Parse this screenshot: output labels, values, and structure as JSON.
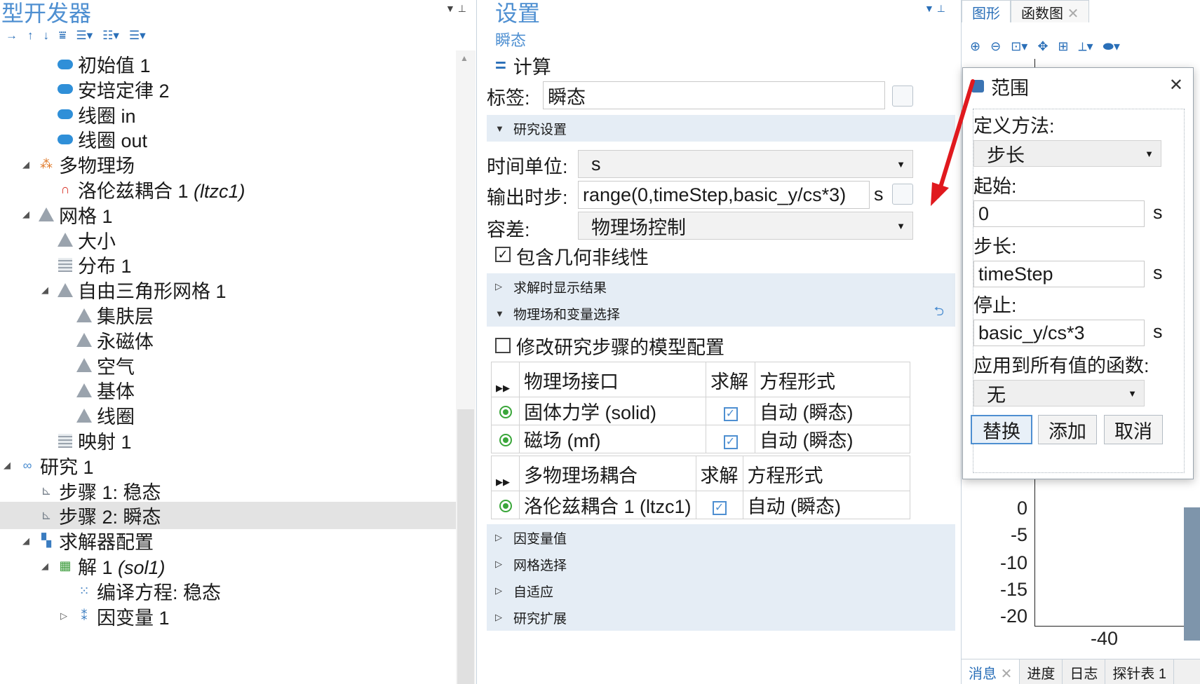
{
  "left": {
    "title": "型开发器",
    "tree": [
      {
        "indent": 3,
        "icon": "initial-values-icon",
        "label": "初始值 1"
      },
      {
        "indent": 3,
        "icon": "ampere-law-icon",
        "label": "安培定律 2"
      },
      {
        "indent": 3,
        "icon": "coil-icon",
        "label": "线圈 in"
      },
      {
        "indent": 3,
        "icon": "coil-icon",
        "label": "线圈 out"
      },
      {
        "indent": 2,
        "icon": "multiphysics-icon",
        "label": "多物理场",
        "toggle": "expanded"
      },
      {
        "indent": 3,
        "icon": "lorentz-coupling-icon",
        "label": "洛伦兹耦合 1",
        "tag": "(ltzc1)"
      },
      {
        "indent": 2,
        "icon": "mesh-icon",
        "label": "网格 1",
        "toggle": "expanded"
      },
      {
        "indent": 3,
        "icon": "size-icon",
        "label": "大小"
      },
      {
        "indent": 3,
        "icon": "distribution-icon",
        "label": "分布 1"
      },
      {
        "indent": 3,
        "icon": "free-triangular-icon",
        "label": "自由三角形网格 1",
        "toggle": "expanded"
      },
      {
        "indent": 4,
        "icon": "size-icon",
        "label": "集肤层"
      },
      {
        "indent": 4,
        "icon": "size-icon",
        "label": "永磁体"
      },
      {
        "indent": 4,
        "icon": "size-icon",
        "label": "空气"
      },
      {
        "indent": 4,
        "icon": "size-icon",
        "label": "基体"
      },
      {
        "indent": 4,
        "icon": "size-icon",
        "label": "线圈"
      },
      {
        "indent": 3,
        "icon": "mapped-icon",
        "label": "映射 1"
      },
      {
        "indent": 1,
        "icon": "study-icon",
        "label": "研究 1",
        "toggle": "expanded"
      },
      {
        "indent": 2,
        "icon": "stationary-step-icon",
        "label": "步骤 1: 稳态"
      },
      {
        "indent": 2,
        "icon": "time-dependent-step-icon",
        "label": "步骤 2: 瞬态",
        "selected": true
      },
      {
        "indent": 2,
        "icon": "solver-config-icon",
        "label": "求解器配置",
        "toggle": "expanded"
      },
      {
        "indent": 3,
        "icon": "solution-icon",
        "label": "解 1",
        "tag": "(sol1)",
        "toggle": "expanded"
      },
      {
        "indent": 4,
        "icon": "compile-equations-icon",
        "label": "编译方程: 稳态"
      },
      {
        "indent": 4,
        "icon": "dependent-variables-icon",
        "label": "因变量 1",
        "toggle": "collapsed"
      }
    ]
  },
  "mid": {
    "title": "设置",
    "subtitle": "瞬态",
    "compute_label": "计算",
    "label_caption": "标签:",
    "label_value": "瞬态",
    "sections": {
      "study_settings": "研究设置",
      "results_while_solving": "求解时显示结果",
      "physics_selection": "物理场和变量选择",
      "dependent_values": "因变量值",
      "mesh_selection": "网格选择",
      "adaptation": "自适应",
      "study_extensions": "研究扩展"
    },
    "time_unit_caption": "时间单位:",
    "time_unit_value": "s",
    "output_times_caption": "输出时步:",
    "output_times_value": "range(0,timeStep,basic_y/cs*3)",
    "output_times_unit": "s",
    "tolerance_caption": "容差:",
    "tolerance_value": "物理场控制",
    "geom_nonlinearity": "包含几何非线性",
    "modify_config": "修改研究步骤的模型配置",
    "physics_table": {
      "headers": [
        "物理场接口",
        "求解",
        "方程形式"
      ],
      "rows": [
        {
          "name": "固体力学 (solid)",
          "form": "自动 (瞬态)"
        },
        {
          "name": "磁场 (mf)",
          "form": "自动 (瞬态)"
        }
      ]
    },
    "coupling_table": {
      "headers": [
        "多物理场耦合",
        "求解",
        "方程形式"
      ],
      "rows": [
        {
          "name": "洛伦兹耦合 1 (ltzc1)",
          "form": "自动 (瞬态)"
        }
      ]
    }
  },
  "right": {
    "tabs": [
      "图形",
      "函数图"
    ],
    "y_ticks": [
      "0",
      "-5",
      "-10",
      "-15",
      "-20"
    ],
    "x_ticks": [
      "-40"
    ],
    "bottom_tabs": [
      "消息",
      "进度",
      "日志",
      "探针表 1"
    ]
  },
  "dialog": {
    "title": "范围",
    "method_caption": "定义方法:",
    "method_value": "步长",
    "start_caption": "起始:",
    "start_value": "0",
    "step_caption": "步长:",
    "step_value": "timeStep",
    "stop_caption": "停止:",
    "stop_value": "basic_y/cs*3",
    "unit": "s",
    "function_caption": "应用到所有值的函数:",
    "function_value": "无",
    "buttons": {
      "replace": "替换",
      "add": "添加",
      "cancel": "取消"
    }
  },
  "colors": {
    "accent": "#4e8fd1",
    "section_bg": "#e5edf5",
    "selected_row": "#e3e3e3",
    "arrow": "#e0191e"
  }
}
